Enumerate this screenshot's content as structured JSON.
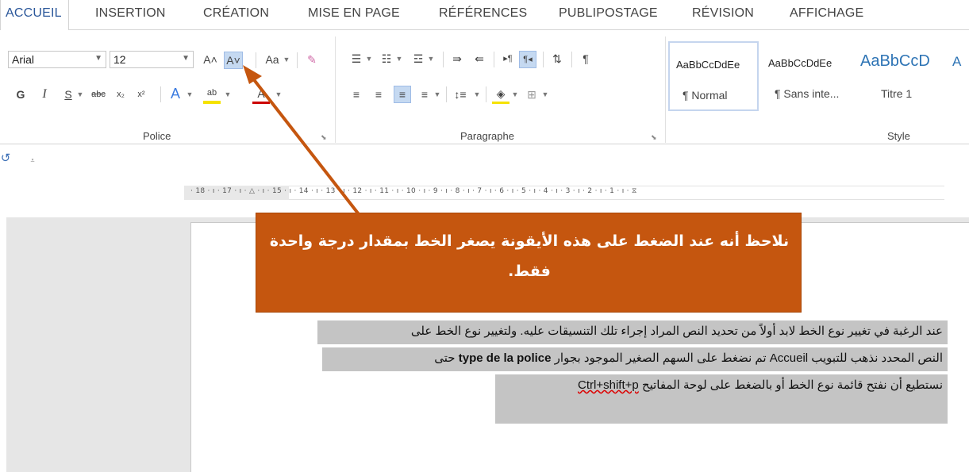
{
  "tabs": [
    "ACCUEIL",
    "INSERTION",
    "CRÉATION",
    "MISE EN PAGE",
    "RÉFÉRENCES",
    "PUBLIPOSTAGE",
    "RÉVISION",
    "AFFICHAGE"
  ],
  "font": {
    "name": "Arial",
    "size": "12",
    "group_label": "Police",
    "grow_glyph": "A˄",
    "shrink_glyph": "A˅",
    "case_glyph": "Aa",
    "bold": "G",
    "italic": "I",
    "underline": "S",
    "strike": "abc",
    "subscript": "x₂",
    "superscript": "x²",
    "text_effects": "A",
    "highlight": "ab",
    "font_color": "A"
  },
  "paragraph": {
    "group_label": "Paragraphe"
  },
  "styles": {
    "group_label": "Style",
    "items": [
      {
        "sample": "AaBbCcDdEe",
        "name": "¶ Normal"
      },
      {
        "sample": "AaBbCcDdEe",
        "name": "¶ Sans inte..."
      },
      {
        "sample": "AaBbCcD",
        "name": "Titre 1"
      },
      {
        "sample": "A",
        "name": ""
      }
    ]
  },
  "ruler": "· 18 · ı · 17 · ı · △ · ı · 15 · ı · 14 · ı · 13 · ı · 12 · ı · 11 · ı · 10 · ı · 9 · ı · 8 · ı · 7 · ı · 6 · ı · 5 · ı · 4 · ı · 3 · ı · 2 · ı · 1 · ı · ⧖",
  "callout": {
    "text": "نلاحظ أنه عند الضغط على هذه الأيقونة يصغر الخط بمقدار درجة واحدة فقط."
  },
  "document": {
    "line1": "عند الرغبة في تغيير نوع الخط لابد أولاً من تحديد النص المراد إجراء تلك التنسيقات عليه. ولتغيير نوع الخط على",
    "line2_a": "النص المحدد نذهب للتبويب",
    "line2_b": "Accueil",
    "line2_c": "تم نضغط على السهم الصغير الموجود بجوار",
    "line2_d": "type de la police",
    "line2_e": "حتى",
    "line3_a": "نستطيع أن نفتح قائمة نوع الخط أو بالضغط على لوحة المفاتيح",
    "line3_b": "Ctrl+shift+p"
  },
  "colors": {
    "accent": "#2b579a",
    "callout": "#c5560f",
    "selection": "#c4c4c4"
  }
}
